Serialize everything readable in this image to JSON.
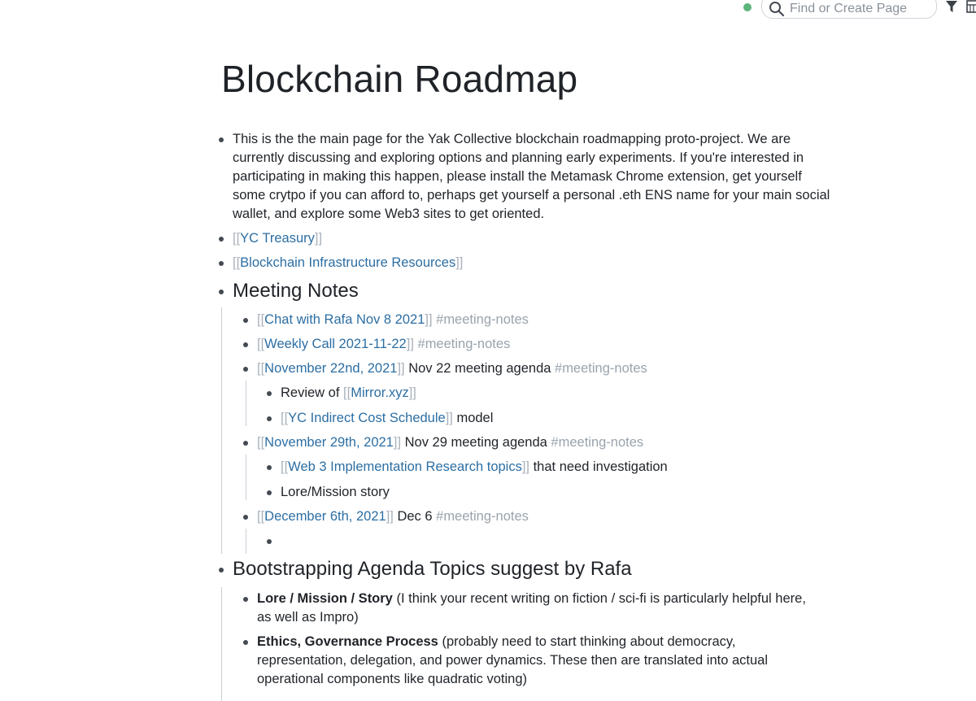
{
  "header": {
    "search_placeholder": "Find or Create Page",
    "colors": {
      "sync": "#5cb57a",
      "link": "#2c6ea3",
      "bracket": "#a9b1bb",
      "tag": "#9aa3ad"
    }
  },
  "page": {
    "title": "Blockchain Roadmap"
  },
  "blocks": {
    "intro": "This is the the main page for the Yak Collective blockchain roadmapping proto-project. We are currently discussing and exploring options and planning early experiments. If you're interested in participating in making this happen, please install the Metamask Chrome extension, get yourself some crytpo if you can afford to, perhaps get yourself a personal .eth ENS name for your main social wallet, and explore some Web3 sites to get oriented.",
    "treasury": "YC Treasury",
    "infra": "Blockchain Infrastructure Resources",
    "meeting_notes": {
      "heading": "Meeting Notes",
      "chat_rafa": "Chat with Rafa Nov 8 2021",
      "weekly_call": "Weekly Call 2021-11-22",
      "nov22": "November 22nd, 2021",
      "nov22_text": " Nov 22 meeting agenda ",
      "review_of": "Review of ",
      "mirror": "Mirror.xyz",
      "yc_indirect": "YC Indirect Cost Schedule",
      "model": " model",
      "nov29": "November 29th, 2021",
      "nov29_text": " Nov 29 meeting agenda ",
      "web3": "Web 3 Implementation Research topics",
      "need_inv": " that need investigation",
      "lore_story": "Lore/Mission story",
      "dec6": "December 6th, 2021",
      "dec6_text": " Dec 6 ",
      "tag": "#meeting-notes"
    },
    "bootstrapping": {
      "heading": "Bootstrapping Agenda Topics suggest by Rafa",
      "lore_bold": "Lore / Mission / Story",
      "lore_rest": " (I think your recent writing on fiction / sci-fi is particularly helpful here, as well as Impro)",
      "ethics_bold": "Ethics, Governance Process",
      "ethics_rest": " (probably need to start thinking about democracy, representation, delegation, and power dynamics. These then are translated into actual operational components like quadratic voting)"
    }
  }
}
